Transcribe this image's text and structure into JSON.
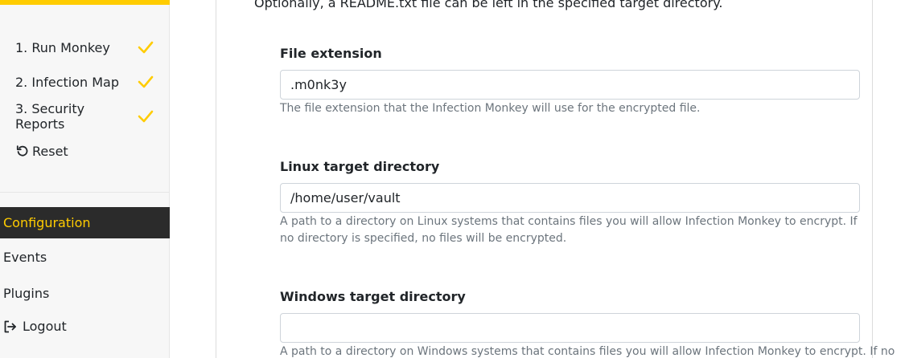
{
  "sidebar": {
    "steps": [
      {
        "label": "1. Run Monkey"
      },
      {
        "label": "2. Infection Map"
      },
      {
        "label": "3. Security Reports"
      }
    ],
    "reset_label": "Reset",
    "links": {
      "configuration": "Configuration",
      "events": "Events",
      "plugins": "Plugins",
      "logout": "Logout"
    }
  },
  "content": {
    "intro": "Optionally, a README.txt file can be left in the specified target directory.",
    "file_extension": {
      "label": "File extension",
      "value": ".m0nk3y",
      "help": "The file extension that the Infection Monkey will use for the encrypted file."
    },
    "linux_dir": {
      "label": "Linux target directory",
      "value": "/home/user/vault",
      "help": "A path to a directory on Linux systems that contains files you will allow Infection Monkey to encrypt. If no directory is specified, no files will be encrypted."
    },
    "windows_dir": {
      "label": "Windows target directory",
      "value": "",
      "help": "A path to a directory on Windows systems that contains files you will allow Infection Monkey to encrypt. If no"
    }
  },
  "colors": {
    "accent": "#ffcc00",
    "active_bg": "#2b2b2b"
  }
}
